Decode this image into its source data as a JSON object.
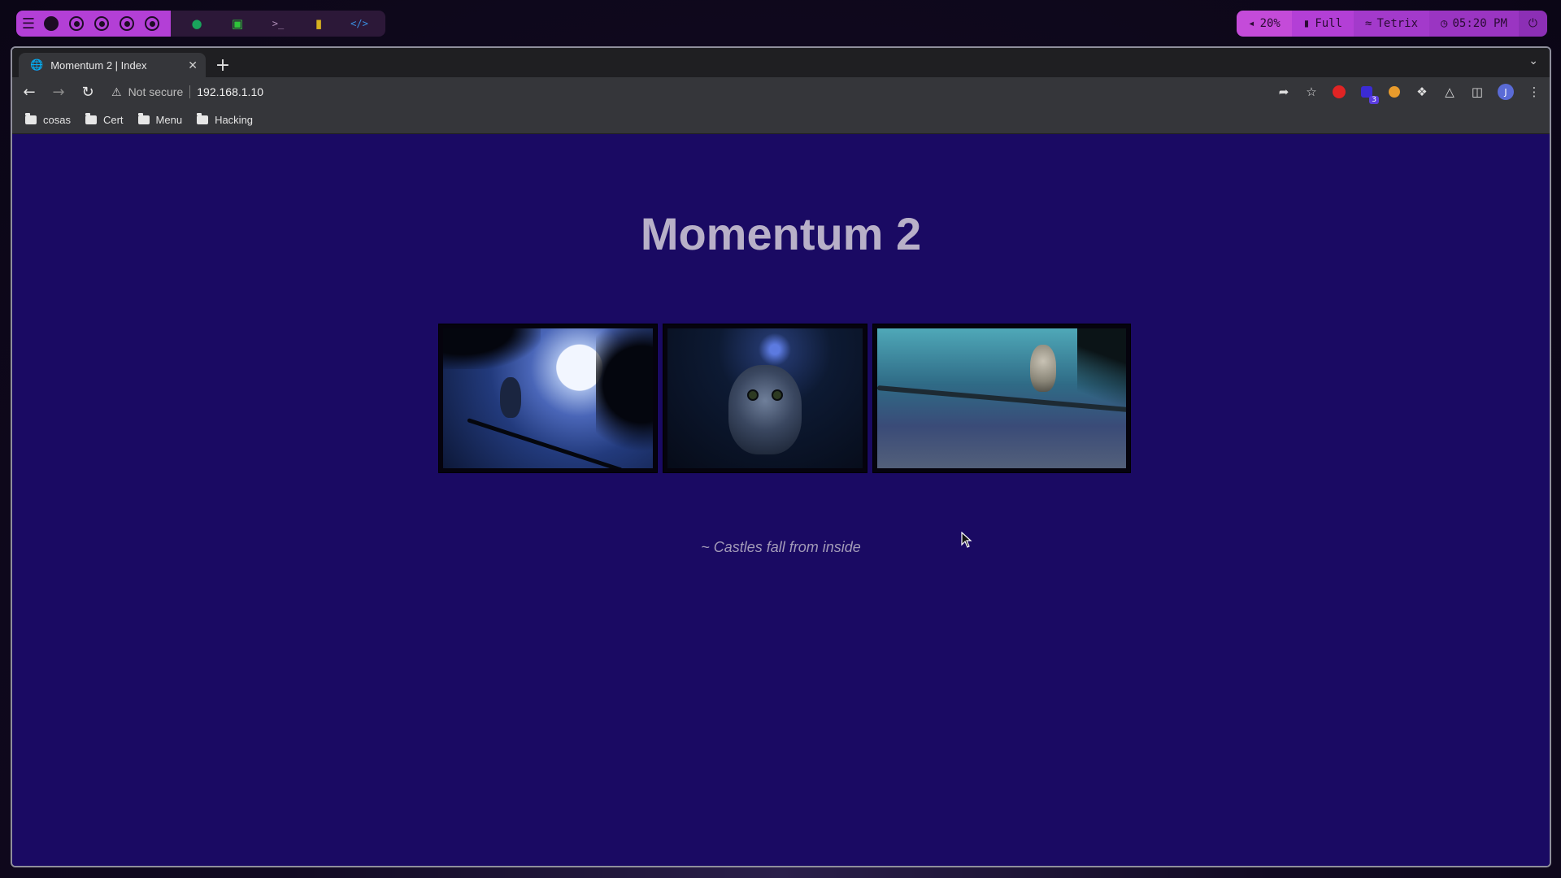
{
  "panel": {
    "workspaces": [
      "ws-1",
      "ws-2",
      "ws-3",
      "ws-4",
      "ws-5"
    ],
    "apps": [
      "browser-icon",
      "package-icon",
      "terminal-icon",
      "folder-icon",
      "code-icon"
    ],
    "volume": "20%",
    "battery": "Full",
    "network": "Tetrix",
    "clock": "05:20 PM"
  },
  "browser": {
    "tab_title": "Momentum 2 | Index",
    "security_label": "Not secure",
    "url": "192.168.1.10",
    "extension_badge": "3",
    "avatar_initial": "J",
    "bookmarks": [
      "cosas",
      "Cert",
      "Menu",
      "Hacking"
    ]
  },
  "page": {
    "title": "Momentum 2",
    "quote": "~ Castles fall from inside"
  },
  "colors": {
    "page_background": "#1a0a63",
    "panel_accent": "#b33fd6"
  }
}
